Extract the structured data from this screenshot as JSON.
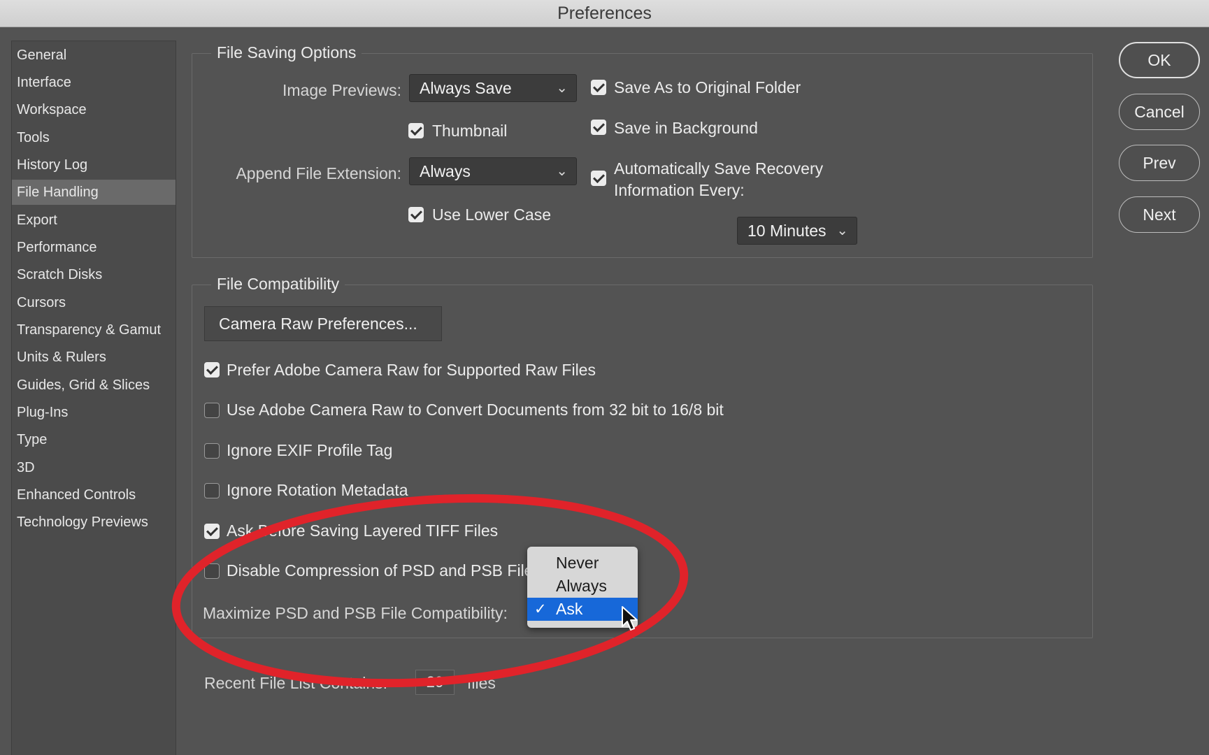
{
  "window": {
    "title": "Preferences"
  },
  "sidebar": {
    "items": [
      {
        "label": "General"
      },
      {
        "label": "Interface"
      },
      {
        "label": "Workspace"
      },
      {
        "label": "Tools"
      },
      {
        "label": "History Log"
      },
      {
        "label": "File Handling",
        "selected": true
      },
      {
        "label": "Export"
      },
      {
        "label": "Performance"
      },
      {
        "label": "Scratch Disks"
      },
      {
        "label": "Cursors"
      },
      {
        "label": "Transparency & Gamut"
      },
      {
        "label": "Units & Rulers"
      },
      {
        "label": "Guides, Grid & Slices"
      },
      {
        "label": "Plug-Ins"
      },
      {
        "label": "Type"
      },
      {
        "label": "3D"
      },
      {
        "label": "Enhanced Controls"
      },
      {
        "label": "Technology Previews"
      }
    ]
  },
  "file_saving": {
    "legend": "File Saving Options",
    "image_previews_label": "Image Previews:",
    "image_previews_value": "Always Save",
    "thumbnail_label": "Thumbnail",
    "thumbnail_checked": true,
    "append_ext_label": "Append File Extension:",
    "append_ext_value": "Always",
    "lower_case_label": "Use Lower Case",
    "lower_case_checked": true,
    "save_original_label": "Save As to Original Folder",
    "save_original_checked": true,
    "save_background_label": "Save in Background",
    "save_background_checked": true,
    "auto_save_label_1": "Automatically Save Recovery",
    "auto_save_label_2": "Information Every:",
    "auto_save_checked": true,
    "interval_value": "10 Minutes"
  },
  "compat": {
    "legend": "File Compatibility",
    "camera_raw_button": "Camera Raw Preferences...",
    "options": [
      {
        "label": "Prefer Adobe Camera Raw for Supported Raw Files",
        "checked": true
      },
      {
        "label": "Use Adobe Camera Raw to Convert Documents from 32 bit to 16/8 bit",
        "checked": false
      },
      {
        "label": "Ignore EXIF Profile Tag",
        "checked": false
      },
      {
        "label": "Ignore Rotation Metadata",
        "checked": false
      },
      {
        "label": "Ask Before Saving Layered TIFF Files",
        "checked": true
      },
      {
        "label": "Disable Compression of PSD and PSB Files",
        "checked": false
      }
    ],
    "maximize_label": "Maximize PSD and PSB File Compatibility:",
    "maximize_menu": {
      "options": [
        "Never",
        "Always",
        "Ask"
      ],
      "selected": "Ask",
      "check_glyph": "✓"
    }
  },
  "recent": {
    "label": "Recent File List Contains:",
    "value": "20",
    "unit": "files"
  },
  "buttons": {
    "ok": "OK",
    "cancel": "Cancel",
    "prev": "Prev",
    "next": "Next"
  },
  "colors": {
    "background": "#535353",
    "highlight_ring": "#e0232a",
    "menu_selection": "#1768d9"
  },
  "icons": {
    "chevron": "chevron-down-icon",
    "checkbox": "checkbox-icon",
    "cursor": "mouse-pointer-icon"
  }
}
